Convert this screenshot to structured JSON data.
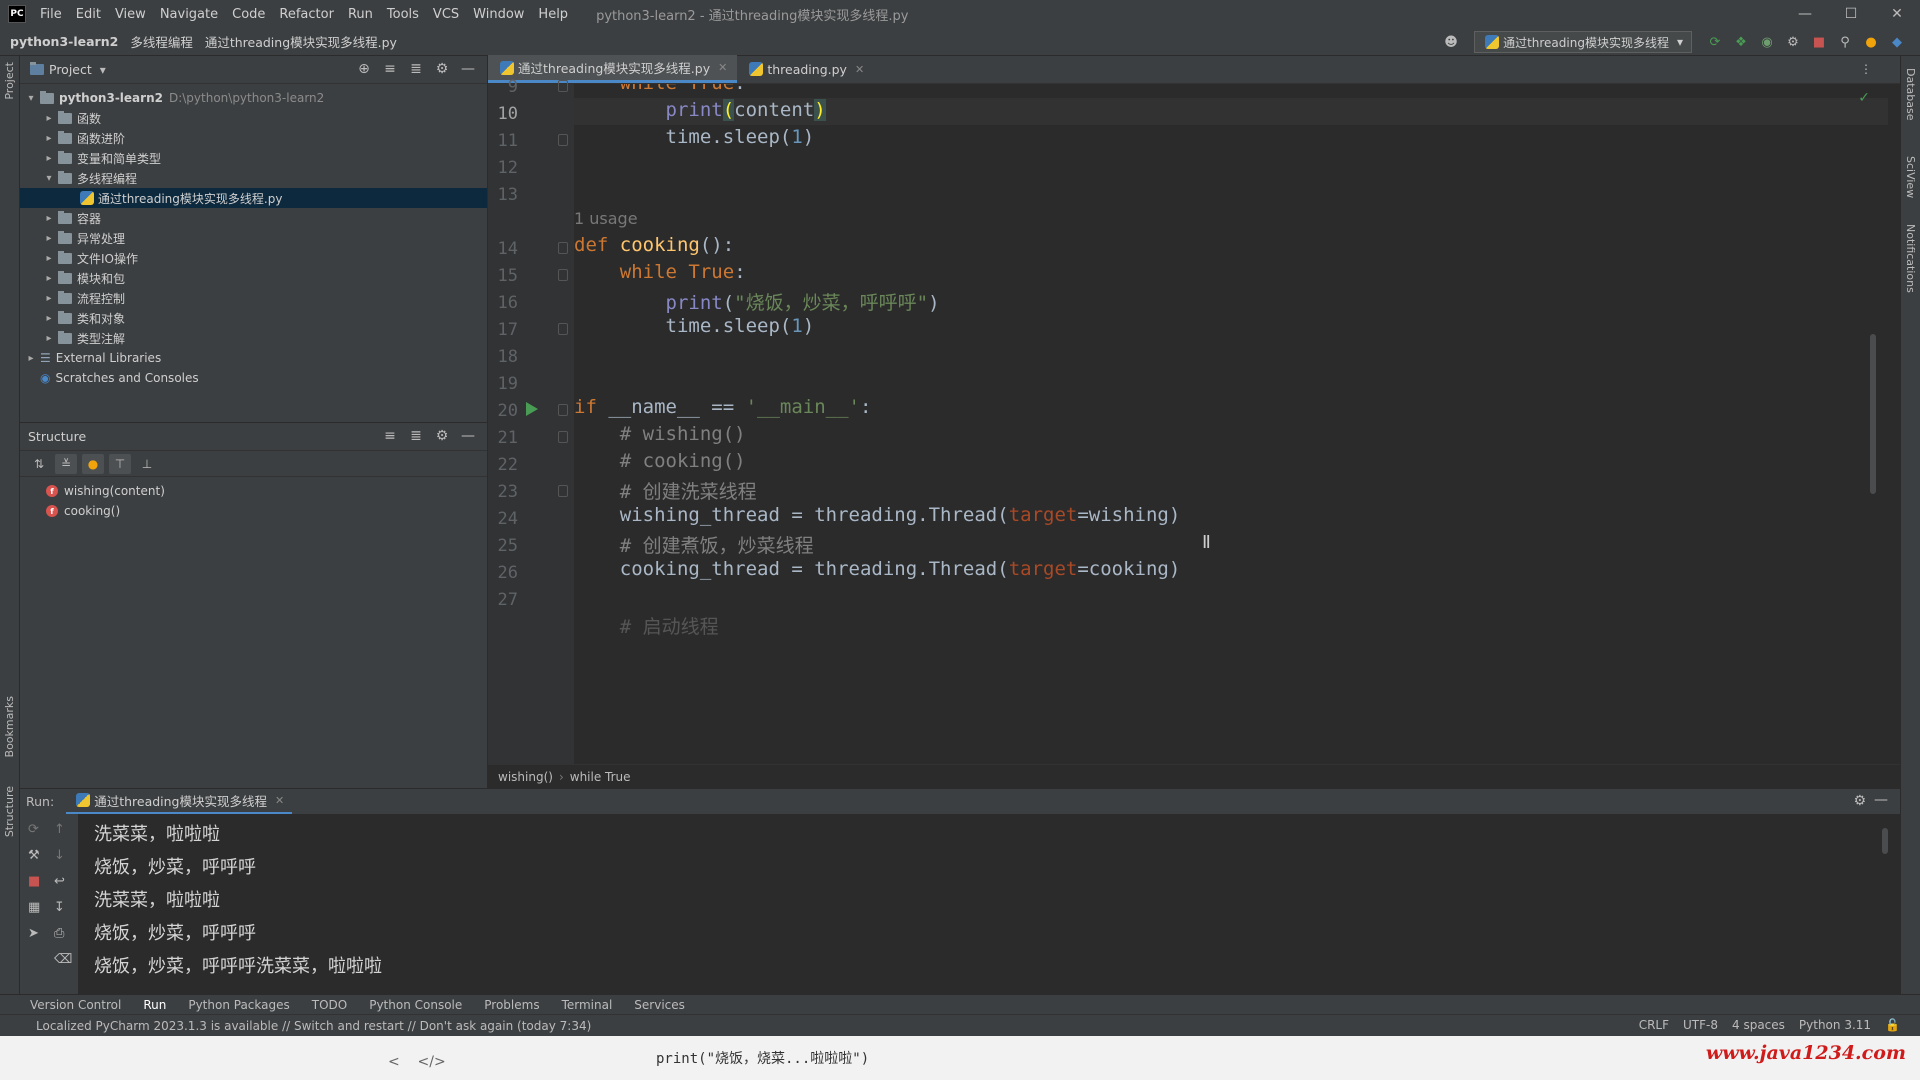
{
  "window": {
    "logo": "PC",
    "title": "python3-learn2 - 通过threading模块实现多线程.py",
    "menu": [
      "File",
      "Edit",
      "View",
      "Navigate",
      "Code",
      "Refactor",
      "Run",
      "Tools",
      "VCS",
      "Window",
      "Help"
    ]
  },
  "navbar": {
    "crumbs": [
      "python3-learn2",
      "多线程编程",
      "通过threading模块实现多线程.py"
    ],
    "run_config": "通过threading模块实现多线程"
  },
  "project": {
    "title": "Project",
    "root_name": "python3-learn2",
    "root_path": "D:\\python\\python3-learn2",
    "folders": [
      "函数",
      "函数进阶",
      "变量和简单类型",
      "多线程编程"
    ],
    "open_file": "通过threading模块实现多线程.py",
    "folders_after": [
      "容器",
      "异常处理",
      "文件IO操作",
      "模块和包",
      "流程控制",
      "类和对象",
      "类型注解"
    ],
    "external": "External Libraries",
    "scratches": "Scratches and Consoles"
  },
  "structure": {
    "title": "Structure",
    "items": [
      "wishing(content)",
      "cooking()"
    ]
  },
  "editor": {
    "tabs": [
      {
        "label": "通过threading模块实现多线程.py",
        "active": true
      },
      {
        "label": "threading.py",
        "active": false
      }
    ],
    "usage_hint": "1 usage",
    "line_numbers": [
      "9",
      "10",
      "11",
      "12",
      "13",
      "14",
      "15",
      "16",
      "17",
      "18",
      "19",
      "20",
      "21",
      "22",
      "23",
      "24",
      "25",
      "26",
      "27"
    ],
    "cooking_string": "\"烧饭，炒菜，呼呼呼\"",
    "comment_wash": "# 创建洗菜线程",
    "comment_cook": "# 创建煮饭，炒菜线程",
    "comment_cut": "# 启动线程",
    "breadcrumb": [
      "wishing()",
      "while True"
    ]
  },
  "run": {
    "label": "Run:",
    "tab": "通过threading模块实现多线程",
    "output": [
      "洗菜菜，啦啦啦",
      "烧饭，炒菜，呼呼呼",
      "洗菜菜，啦啦啦",
      "烧饭，炒菜，呼呼呼",
      "烧饭，炒菜，呼呼呼洗菜菜，啦啦啦"
    ]
  },
  "toolwindows": [
    "Version Control",
    "Run",
    "Python Packages",
    "TODO",
    "Python Console",
    "Problems",
    "Terminal",
    "Services"
  ],
  "status": {
    "message": "Localized PyCharm 2023.1.3 is available // Switch and restart // Don't ask again (today 7:34)",
    "line_sep": "CRLF",
    "encoding": "UTF-8",
    "indent": "4 spaces",
    "interpreter": "Python 3.11"
  },
  "side_labels": {
    "left_top": "Project",
    "left_bookmarks": "Bookmarks",
    "left_structure": "Structure",
    "right_database": "Database",
    "right_sciview": "SciView",
    "right_notifications": "Notifications"
  },
  "bottom_strip": {
    "peek_code": "print(\"烧饭，烧菜...啦啦啦\")",
    "watermark": "www.java1234.com"
  },
  "colors": {
    "accent": "#4a88c7",
    "run_green": "#499c54",
    "keyword": "#cc7832",
    "function": "#ffc66d",
    "watermark": "#d01b1b"
  }
}
